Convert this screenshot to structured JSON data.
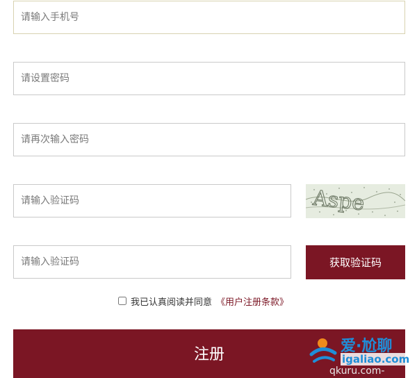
{
  "form": {
    "phone_placeholder": "请输入手机号",
    "password_placeholder": "请设置密码",
    "password_confirm_placeholder": "请再次输入密码",
    "image_code_placeholder": "请输入验证码",
    "sms_code_placeholder": "请输入验证码",
    "captcha_text": "Aspe",
    "sms_button_label": "获取验证码",
    "agree_text": "我已认真阅读并同意",
    "terms_link": "《用户注册条款》",
    "register_button_label": "注册"
  },
  "watermark": {
    "main": "爱·尬聊",
    "url": "igaliao.com",
    "sub": "qkuru.com-"
  },
  "colors": {
    "accent": "#7b1624",
    "watermark_blue": "#1f8ed8"
  }
}
